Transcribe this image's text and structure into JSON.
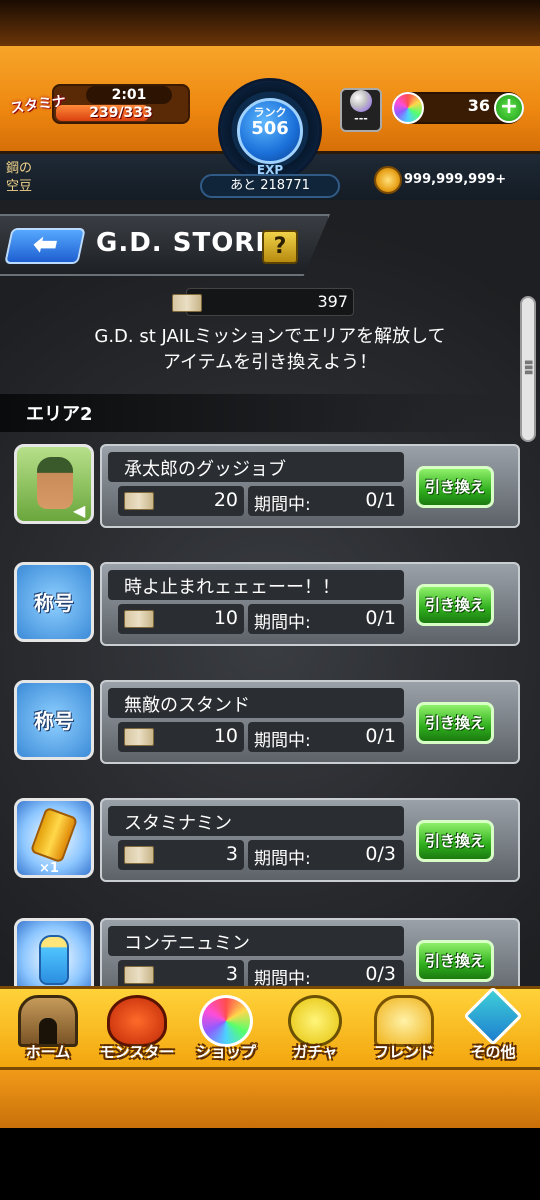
{
  "header": {
    "stamina_label": "スタミナ",
    "stamina_timer": "2:01",
    "stamina_value": "239/333",
    "stamina_fraction": 0.718,
    "rank_label": "ランク",
    "rank_value": "506",
    "exp_label": "EXP",
    "exp_remaining": "あと 218771",
    "item_slot_text": "---",
    "orb_count": "36",
    "orb_add": "+",
    "user_title": "鋼の",
    "user_name": "空豆",
    "coins": "999,999,999+"
  },
  "store": {
    "back_arrow": "⬅",
    "title": "G.D. STORE",
    "help": "?",
    "ticket_total": "397",
    "description_line1": "G.D. st JAILミッションでエリアを解放して",
    "description_line2": "アイテムを引き換えよう！",
    "section_label": "エリア2",
    "period_label": "期間中:",
    "exchange_label": "引き換え",
    "title_badge": "称号",
    "count_badge": "×1",
    "items": [
      {
        "name": "承太郎のグッジョブ",
        "cost": "20",
        "limit": "0/1",
        "icon": "character-portrait-icon"
      },
      {
        "name": "時よ止まれェェェーー！！",
        "cost": "10",
        "limit": "0/1",
        "icon": "title-badge-icon"
      },
      {
        "name": "無敵のスタンド",
        "cost": "10",
        "limit": "0/1",
        "icon": "title-badge-icon"
      },
      {
        "name": "スタミナミン",
        "cost": "3",
        "limit": "0/3",
        "icon": "stamina-can-icon"
      },
      {
        "name": "コンテニュミン",
        "cost": "3",
        "limit": "0/3",
        "icon": "continue-potion-icon"
      }
    ]
  },
  "nav": {
    "home": "ホーム",
    "monster": "モンスター",
    "shop": "ショップ",
    "gacha": "ガチャ",
    "friend": "フレンド",
    "other": "その他"
  },
  "colors": {
    "header_orange": "#f29a1c",
    "exchange_green": "#2fae1d",
    "rank_blue": "#1a6fd8",
    "nav_yellow": "#ffd23a"
  }
}
